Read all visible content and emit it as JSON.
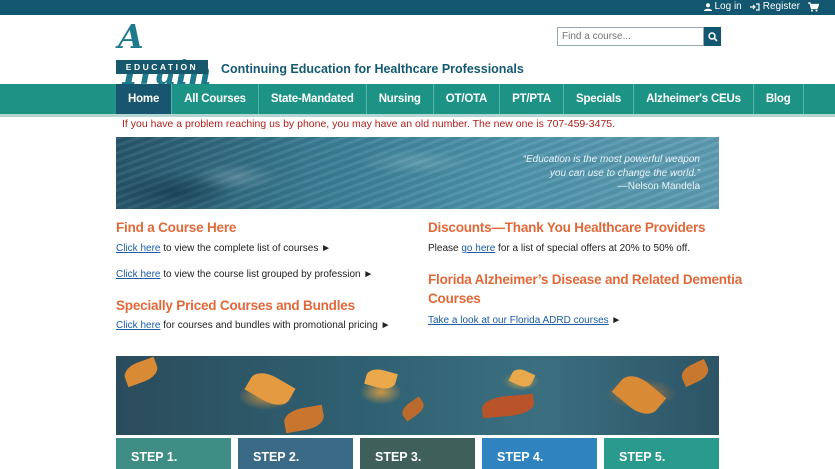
{
  "topbar": {
    "login": "Log in",
    "register": "Register",
    "icons": {
      "login": "user-icon",
      "register": "sign-in-icon",
      "cart": "cart-icon"
    }
  },
  "logo": {
    "script": "A Train",
    "sub": "EDUCATION"
  },
  "tagline": "Continuing Education for Healthcare Professionals",
  "search": {
    "placeholder": "Find a course...",
    "icon": "search-icon"
  },
  "nav": {
    "items": [
      "Home",
      "All Courses",
      "State-Mandated",
      "Nursing",
      "OT/OTA",
      "PT/PTA",
      "Specials",
      "Alzheimer's CEUs",
      "Blog"
    ],
    "active": "Home"
  },
  "notice": "If you have a problem reaching us by phone, you may have an old number. The new one is 707-459-3475.",
  "hero_quote": {
    "line1": "“Education is the most powerful weapon",
    "line2": "you can use to change the world.”",
    "author": "—Nelson Mandela"
  },
  "left": {
    "find_title": "Find a Course Here",
    "link1": "Click here",
    "text1": " to view the complete list of courses ►",
    "link2": "Click here",
    "text2": " to view the course list grouped by profession ►",
    "special_title": "Specially Priced Courses and Bundles",
    "link3": "Click here",
    "text3": " for courses and bundles with promotional pricing ►"
  },
  "right": {
    "discount_title": "Discounts—Thank You Healthcare Providers",
    "text_pre": "Please ",
    "link": "go here",
    "text_post": " for a list of special offers at 20% to 50% off.",
    "fl_title_1": "Florida Alzheimer’s Disease and Related Dementia",
    "fl_title_2": "Courses",
    "fl_link": "Take a look at our Florida ADRD courses",
    "fl_arrow": " ►"
  },
  "steps": [
    {
      "label": "STEP 1.",
      "color": "#3f8e86"
    },
    {
      "label": "STEP 2.",
      "color": "#3a6a85"
    },
    {
      "label": "STEP 3.",
      "color": "#3f5f5a"
    },
    {
      "label": "STEP 4.",
      "color": "#2f84c0"
    },
    {
      "label": "STEP 5.",
      "color": "#2a9a8c"
    }
  ],
  "colors": {
    "topbar": "#13566f",
    "nav": "#1d9385",
    "nav_active": "#17566e",
    "heading": "#e0693a",
    "notice": "#b0201c"
  }
}
